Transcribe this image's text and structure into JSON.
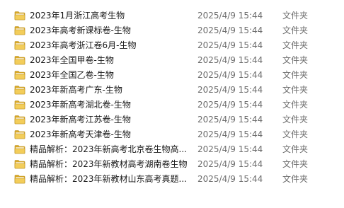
{
  "icons": {
    "folder": "folder-icon"
  },
  "colors": {
    "folder_body": "#f3cd5a",
    "folder_dark": "#d9a928",
    "folder_edge": "#b88d1c",
    "meta_text": "#6d6d6d",
    "name_text": "#1a1a1a"
  },
  "files": [
    {
      "name": "2023年1月浙江高考生物",
      "modified": "2025/4/9 15:44",
      "type": "文件夹"
    },
    {
      "name": "2023年高考新课标卷-生物",
      "modified": "2025/4/9 15:44",
      "type": "文件夹"
    },
    {
      "name": "2023年高考浙江卷6月-生物",
      "modified": "2025/4/9 15:44",
      "type": "文件夹"
    },
    {
      "name": "2023年全国甲卷-生物",
      "modified": "2025/4/9 15:44",
      "type": "文件夹"
    },
    {
      "name": "2023年全国乙卷-生物",
      "modified": "2025/4/9 15:44",
      "type": "文件夹"
    },
    {
      "name": "2023年新高考广东-生物",
      "modified": "2025/4/9 15:44",
      "type": "文件夹"
    },
    {
      "name": "2023年新高考湖北卷-生物",
      "modified": "2025/4/9 15:44",
      "type": "文件夹"
    },
    {
      "name": "2023年新高考江苏卷-生物",
      "modified": "2025/4/9 15:44",
      "type": "文件夹"
    },
    {
      "name": "2023年新高考天津卷-生物",
      "modified": "2025/4/9 15:44",
      "type": "文件夹"
    },
    {
      "name": "精品解析：2023年新高考北京卷生物高...",
      "modified": "2025/4/9 15:44",
      "type": "文件夹"
    },
    {
      "name": "精品解析：2023年新教材高考湖南卷生物",
      "modified": "2025/4/9 15:44",
      "type": "文件夹"
    },
    {
      "name": "精品解析：2023年新教材山东高考真题...",
      "modified": "2025/4/9 15:44",
      "type": "文件夹"
    }
  ]
}
